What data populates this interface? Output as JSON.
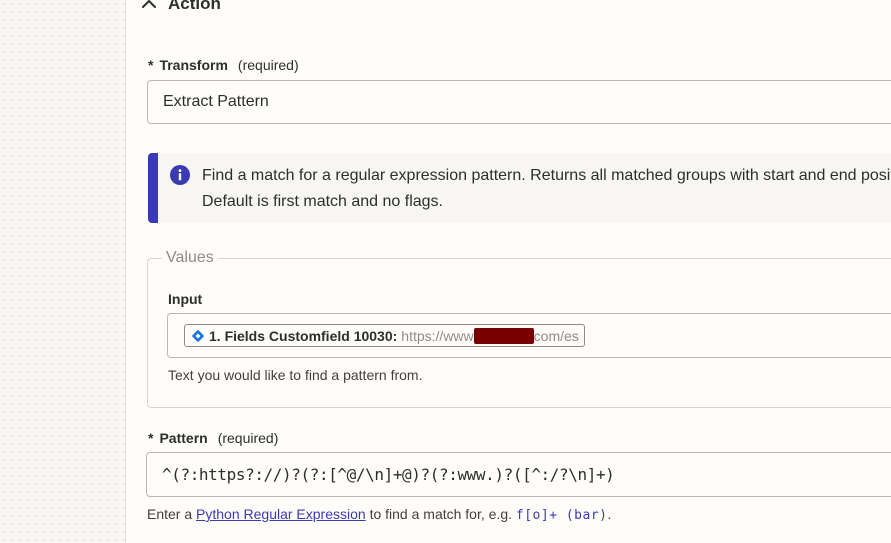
{
  "section": {
    "title": "Action"
  },
  "transform": {
    "label": "Transform",
    "required_marker": "*",
    "required_text": "(required)",
    "value": "Extract Pattern"
  },
  "info": {
    "text": "Find a match for a regular expression pattern. Returns all matched groups with start and end position. Default is first match and no flags."
  },
  "values": {
    "legend": "Values",
    "input": {
      "label": "Input",
      "pill_label": "1. Fields Customfield 10030:",
      "pill_value_prefix": "https://www",
      "pill_value_suffix": "com/es",
      "help": "Text you would like to find a pattern from."
    }
  },
  "pattern": {
    "label": "Pattern",
    "required_marker": "*",
    "required_text": "(required)",
    "value": "^(?:https?://)?(?:[^@/\\n]+@)?(?:www.)?([^:/?\\n]+)",
    "help_prefix": "Enter a",
    "help_link": "Python Regular Expression",
    "help_mid": "to find a match for, e.g.",
    "help_example": "f[o]+ (bar)",
    "help_end": "."
  },
  "colors": {
    "accent": "#3b3bb1",
    "redaction": "#7a0000",
    "zap_blue": "#1a73e8"
  }
}
